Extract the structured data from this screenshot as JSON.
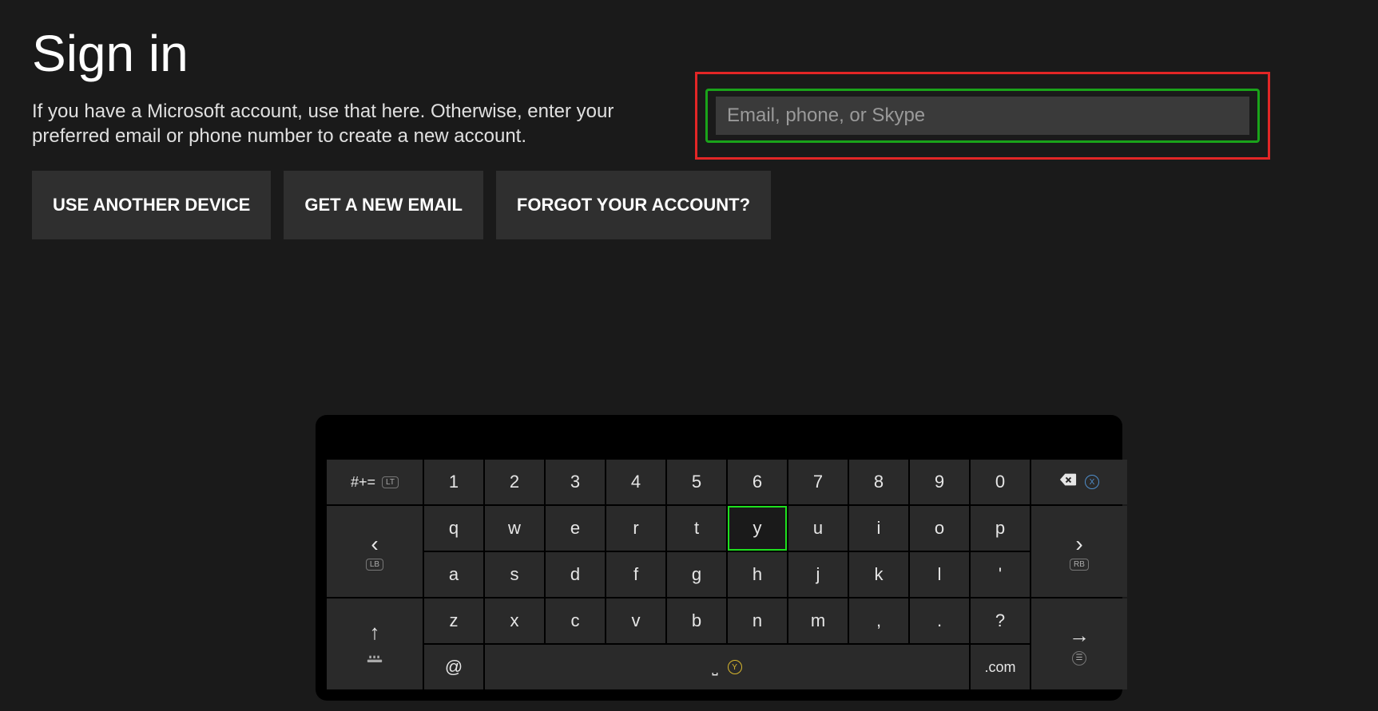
{
  "page": {
    "title": "Sign in",
    "subtitle": "If you have a Microsoft account, use that here. Otherwise, enter your preferred email or phone number to create a new account."
  },
  "buttons": {
    "another_device": "USE ANOTHER DEVICE",
    "new_email": "GET A NEW EMAIL",
    "forgot": "FORGOT YOUR ACCOUNT?"
  },
  "input": {
    "placeholder": "Email, phone, or Skype",
    "value": ""
  },
  "keyboard": {
    "symbols_label": "#+=",
    "lt_label": "LT",
    "lb_label": "LB",
    "rb_label": "RB",
    "x_label": "X",
    "y_label": "Y",
    "row_num": [
      "1",
      "2",
      "3",
      "4",
      "5",
      "6",
      "7",
      "8",
      "9",
      "0"
    ],
    "row_q": [
      "q",
      "w",
      "e",
      "r",
      "t",
      "y",
      "u",
      "i",
      "o",
      "p"
    ],
    "row_a": [
      "a",
      "s",
      "d",
      "f",
      "g",
      "h",
      "j",
      "k",
      "l",
      "'"
    ],
    "row_z": [
      "z",
      "x",
      "c",
      "v",
      "b",
      "n",
      "m",
      ",",
      ".",
      "?"
    ],
    "at": "@",
    "dotcom": ".com",
    "selected_key": "y",
    "space_glyph": "⎵"
  }
}
